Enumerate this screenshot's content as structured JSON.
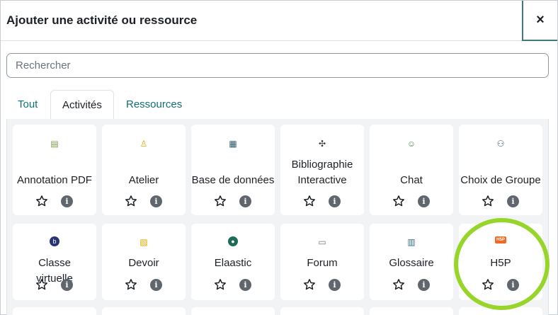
{
  "modal": {
    "title": "Ajouter une activité ou ressource",
    "close_label": "×"
  },
  "search": {
    "placeholder": "Rechercher"
  },
  "tabs": [
    {
      "label": "Tout",
      "active": false
    },
    {
      "label": "Activités",
      "active": true
    },
    {
      "label": "Ressources",
      "active": false
    }
  ],
  "cards": [
    {
      "label": "Annotation PDF",
      "icon": "pdf-annotation-icon",
      "color": "#7a9a4a"
    },
    {
      "label": "Atelier",
      "icon": "workshop-icon",
      "color": "#e0a800"
    },
    {
      "label": "Base de données",
      "icon": "database-icon",
      "color": "#2f5d6a"
    },
    {
      "label": "Bibliographie Interactive",
      "icon": "puzzle-icon",
      "color": "#333333"
    },
    {
      "label": "Chat",
      "icon": "chat-icon",
      "color": "#4a8a5a"
    },
    {
      "label": "Choix de Groupe",
      "icon": "group-choice-icon",
      "color": "#3a5a8a"
    },
    {
      "label": "Classe virtuelle",
      "icon": "bigbluebutton-icon",
      "color": "#283274"
    },
    {
      "label": "Devoir",
      "icon": "assignment-icon",
      "color": "#e0a800"
    },
    {
      "label": "Elaastic",
      "icon": "elaastic-icon",
      "color": "#1f6b5a"
    },
    {
      "label": "Forum",
      "icon": "forum-icon",
      "color": "#777777"
    },
    {
      "label": "Glossaire",
      "icon": "glossary-icon",
      "color": "#2f6a7a"
    },
    {
      "label": "H5P",
      "icon": "h5p-icon",
      "color": "#f26a21"
    }
  ],
  "colors": {
    "accent": "#116f73",
    "highlight": "#97d52a"
  }
}
